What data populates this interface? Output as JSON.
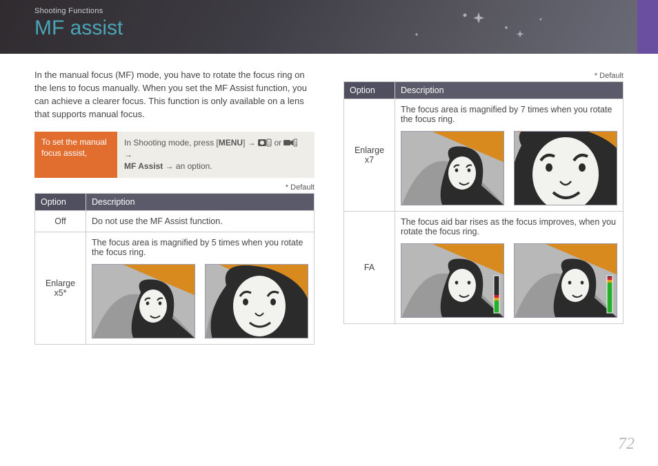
{
  "breadcrumb": "Shooting Functions",
  "title": "MF assist",
  "intro": "In the manual focus (MF) mode, you have to rotate the focus ring on the lens to focus manually. When you set the MF Assist function, you can achieve a clearer focus. This function is only available on a lens that supports manual focus.",
  "setbox": {
    "label": "To set the manual focus assist,",
    "instr_prefix": "In Shooting mode, press [",
    "menu_key": "MENU",
    "instr_mid": "] →",
    "or": "or",
    "arrow": "→",
    "mf_assist": "MF Assist",
    "instr_suffix": "an option."
  },
  "default_note": "* Default",
  "table": {
    "header_option": "Option",
    "header_desc": "Description"
  },
  "left_rows": [
    {
      "name": "Off",
      "desc": "Do not use the MF Assist function."
    },
    {
      "name": "Enlarge x5*",
      "desc": "The focus area is magnified by 5 times when you rotate the focus ring."
    }
  ],
  "right_rows": [
    {
      "name": "Enlarge x7",
      "desc": "The focus area is magnified by 7 times when you rotate the focus ring."
    },
    {
      "name": "FA",
      "desc": "The focus aid bar rises as the focus improves, when you rotate the focus ring."
    }
  ],
  "page_number": "72"
}
